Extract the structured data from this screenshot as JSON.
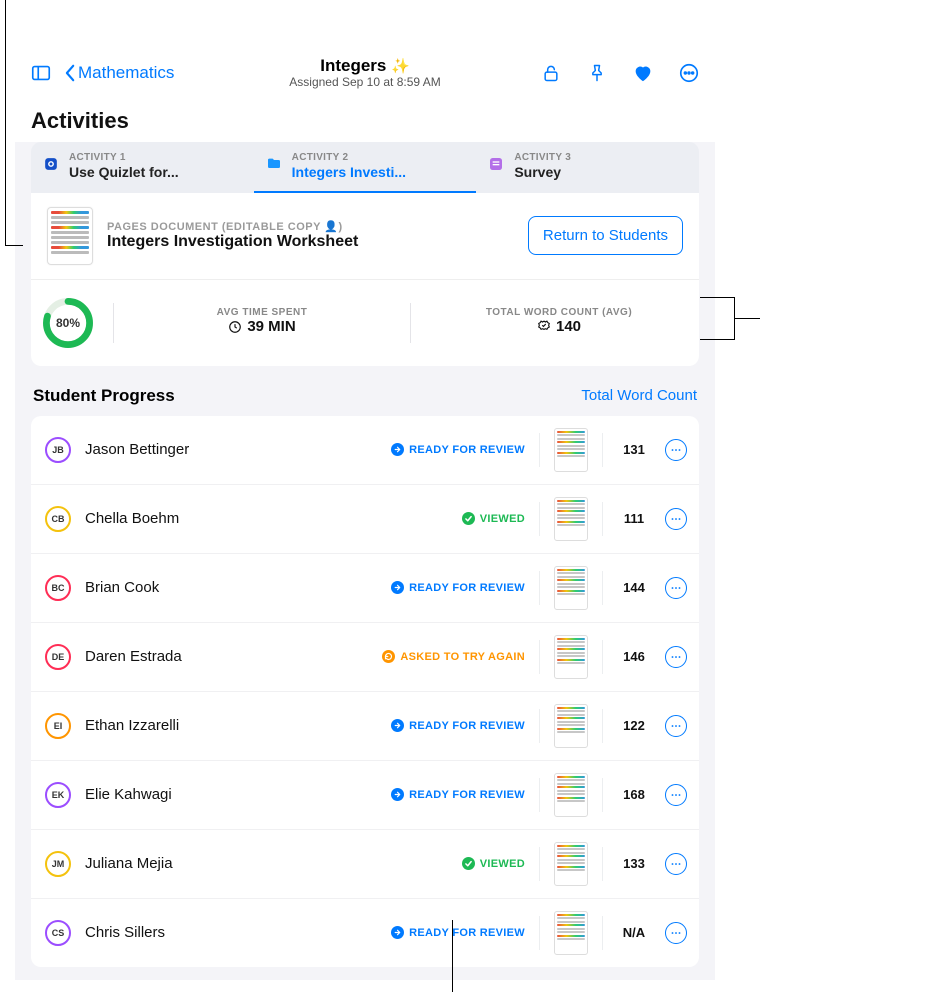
{
  "nav": {
    "back_label": "Mathematics",
    "title": "Integers",
    "subtitle": "Assigned Sep 10 at 8:59 AM"
  },
  "section_title": "Activities",
  "tabs": [
    {
      "eyebrow": "ACTIVITY 1",
      "name": "Use Quizlet for...",
      "active": false,
      "icon_color": "#1550c8"
    },
    {
      "eyebrow": "ACTIVITY 2",
      "name": "Integers Investi...",
      "active": true,
      "icon_color": "#1996ff"
    },
    {
      "eyebrow": "ACTIVITY 3",
      "name": "Survey",
      "active": false,
      "icon_color": "#b36ee8"
    }
  ],
  "document": {
    "kind": "PAGES DOCUMENT (EDITABLE COPY 👤)",
    "name": "Integers Investigation Worksheet",
    "button": "Return to Students"
  },
  "stats": {
    "progress_pct": 80,
    "progress_label": "80%",
    "avg_time_label": "AVG TIME SPENT",
    "avg_time_value": "39 MIN",
    "word_label": "TOTAL WORD COUNT (AVG)",
    "word_value": "140"
  },
  "progress": {
    "heading": "Student Progress",
    "link": "Total Word Count"
  },
  "status_styles": {
    "ready": {
      "label": "READY FOR REVIEW",
      "color": "#007aff",
      "icon": "arrow"
    },
    "viewed": {
      "label": "VIEWED",
      "color": "#1db954",
      "icon": "check"
    },
    "retry": {
      "label": "ASKED TO TRY AGAIN",
      "color": "#ff9500",
      "icon": "refresh"
    }
  },
  "students": [
    {
      "initials": "JB",
      "name": "Jason Bettinger",
      "ring": "#9b4dff",
      "status": "ready",
      "count": "131"
    },
    {
      "initials": "CB",
      "name": "Chella Boehm",
      "ring": "#f4c20d",
      "status": "viewed",
      "count": "111"
    },
    {
      "initials": "BC",
      "name": "Brian Cook",
      "ring": "#ff2d55",
      "status": "ready",
      "count": "144"
    },
    {
      "initials": "DE",
      "name": "Daren Estrada",
      "ring": "#ff2d55",
      "status": "retry",
      "count": "146"
    },
    {
      "initials": "EI",
      "name": "Ethan Izzarelli",
      "ring": "#ff9500",
      "status": "ready",
      "count": "122"
    },
    {
      "initials": "EK",
      "name": "Elie Kahwagi",
      "ring": "#9b4dff",
      "status": "ready",
      "count": "168"
    },
    {
      "initials": "JM",
      "name": "Juliana Mejia",
      "ring": "#f4c20d",
      "status": "viewed",
      "count": "133"
    },
    {
      "initials": "CS",
      "name": "Chris Sillers",
      "ring": "#9b4dff",
      "status": "ready",
      "count": "N/A"
    }
  ]
}
